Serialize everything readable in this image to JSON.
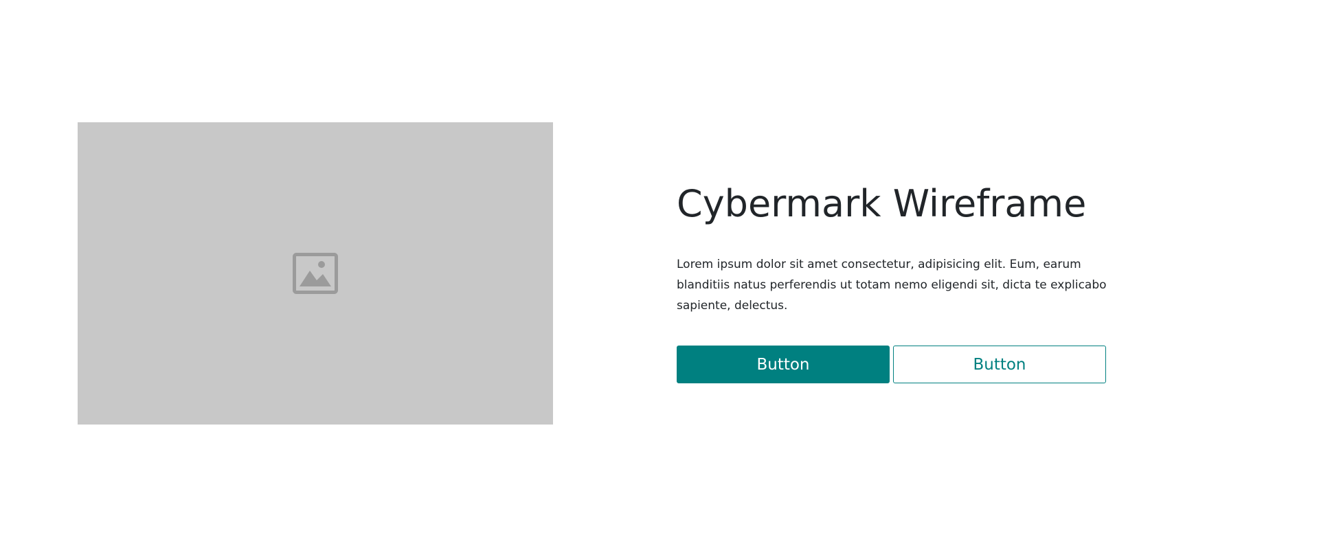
{
  "hero": {
    "image": {
      "icon": "image-icon",
      "background_color": "#c8c8c8",
      "icon_color": "#9b9b9b"
    },
    "title": "Cybermark Wireframe",
    "description": "Lorem ipsum dolor sit amet consectetur, adipisicing elit. Eum, earum blanditiis natus perferendis ut totam nemo eligendi sit, dicta te explicabo sapiente, delectus.",
    "primary_button_label": "Button",
    "secondary_button_label": "Button",
    "accent_color": "#008080"
  }
}
